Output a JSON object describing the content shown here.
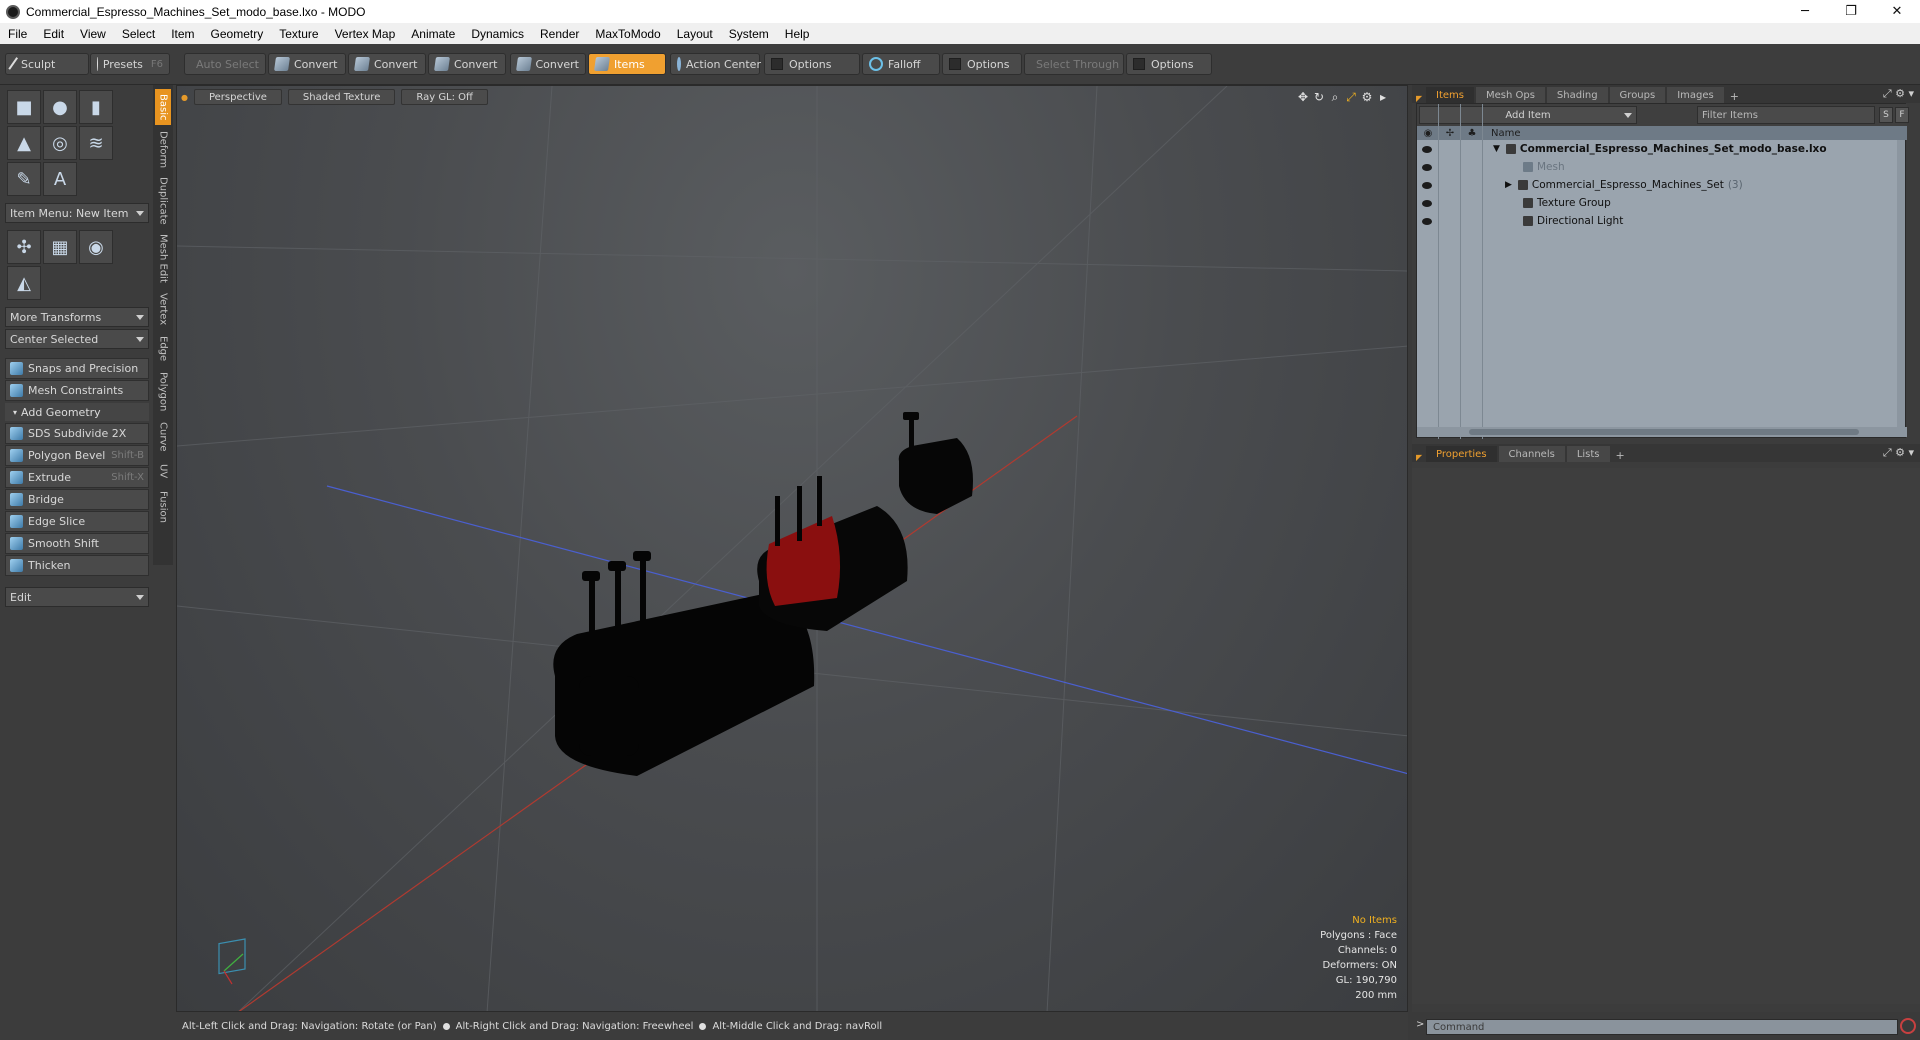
{
  "window": {
    "title": "Commercial_Espresso_Machines_Set_modo_base.lxo - MODO",
    "controls": [
      "─",
      "❐",
      "✕"
    ]
  },
  "menu": [
    "File",
    "Edit",
    "View",
    "Select",
    "Item",
    "Geometry",
    "Texture",
    "Vertex Map",
    "Animate",
    "Dynamics",
    "Render",
    "MaxToModo",
    "Layout",
    "System",
    "Help"
  ],
  "toolbar": {
    "sculpt": "Sculpt",
    "presets": "Presets",
    "presets_key": "F6",
    "auto_select": "Auto Select",
    "convert_1": "Convert",
    "convert_2": "Convert",
    "convert_3": "Convert",
    "convert_4": "Convert",
    "items": "Items",
    "action_center": "Action Center",
    "options_1": "Options",
    "falloff": "Falloff",
    "options_2": "Options",
    "select_through": "Select Through",
    "options_3": "Options"
  },
  "left_panel": {
    "item_menu": "Item Menu: New Item",
    "more_transforms": "More Transforms",
    "center_selected": "Center Selected",
    "snaps": "Snaps and Precision",
    "mesh_constraints": "Mesh Constraints",
    "add_geometry": "Add Geometry",
    "tools": [
      {
        "label": "SDS Subdivide 2X",
        "shortcut": ""
      },
      {
        "label": "Polygon Bevel",
        "shortcut": "Shift-B"
      },
      {
        "label": "Extrude",
        "shortcut": "Shift-X"
      },
      {
        "label": "Bridge",
        "shortcut": ""
      },
      {
        "label": "Edge Slice",
        "shortcut": ""
      },
      {
        "label": "Smooth Shift",
        "shortcut": ""
      },
      {
        "label": "Thicken",
        "shortcut": ""
      }
    ],
    "edit": "Edit",
    "vtabs": [
      "Basic",
      "Deform",
      "Duplicate",
      "Mesh Edit",
      "Vertex",
      "Edge",
      "Polygon",
      "Curve",
      "UV",
      "Fusion"
    ]
  },
  "viewport": {
    "view": "Perspective",
    "shading": "Shaded Texture",
    "raygl": "Ray GL: Off",
    "stats": {
      "selection": "No Items",
      "polygons": "Polygons : Face",
      "channels": "Channels: 0",
      "deformers": "Deformers: ON",
      "gl": "GL: 190,790",
      "grid": "200 mm"
    }
  },
  "status": {
    "hint1": "Alt-Left Click and Drag: Navigation: Rotate (or Pan)",
    "hint2": "Alt-Right Click and Drag: Navigation: Freewheel",
    "hint3": "Alt-Middle Click and Drag: navRoll"
  },
  "right_panel": {
    "top_tabs": [
      "Items",
      "Mesh Ops",
      "Shading",
      "Groups",
      "Images"
    ],
    "add_item": "Add Item",
    "filter_placeholder": "Filter Items",
    "col_name": "Name",
    "tree": [
      {
        "label": "Commercial_Espresso_Machines_Set_modo_base.lxo",
        "count": ""
      },
      {
        "label": "Mesh",
        "count": ""
      },
      {
        "label": "Commercial_Espresso_Machines_Set",
        "count": "(3)"
      },
      {
        "label": "Texture Group",
        "count": ""
      },
      {
        "label": "Directional Light",
        "count": ""
      }
    ],
    "bottom_tabs": [
      "Properties",
      "Channels",
      "Lists"
    ],
    "command_placeholder": "Command"
  },
  "colors": {
    "accent": "#f0a030",
    "machine_red": "#8a0f0f"
  }
}
